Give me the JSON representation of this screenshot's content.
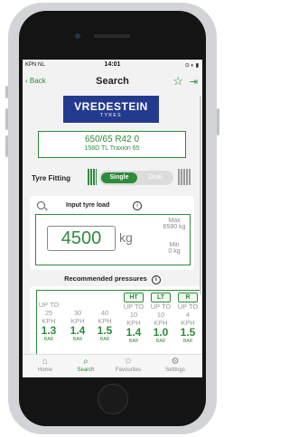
{
  "status": {
    "carrier": "KPN NL",
    "time": "14:01",
    "icons": "⊙ ◐ ▮"
  },
  "nav": {
    "back_label": "Back",
    "title": "Search"
  },
  "logo": {
    "brand": "VREDESTEIN",
    "sub": "TYRES"
  },
  "tyre": {
    "size": "650/65 R42 0",
    "description": "158D TL Traxion 65"
  },
  "fitting": {
    "label": "Tyre Fitting",
    "single": "Single",
    "dual": "Dual",
    "selected": "Single"
  },
  "load": {
    "title": "Input tyre load",
    "value": "4500",
    "unit": "kg",
    "max_label": "Max",
    "max_value": "6580 kg",
    "min_label": "Min",
    "min_value": "0 kg"
  },
  "pressures": {
    "title": "Recommended pressures",
    "columns": [
      {
        "tag": "",
        "l1": "UP TO",
        "l2": "25",
        "l3": "KPH",
        "value": "1.3",
        "unit": "BAR"
      },
      {
        "tag": "",
        "l1": "",
        "l2": "30",
        "l3": "KPH",
        "value": "1.4",
        "unit": "BAR"
      },
      {
        "tag": "",
        "l1": "",
        "l2": "40",
        "l3": "KPH",
        "value": "1.5",
        "unit": "BAR"
      },
      {
        "tag": "HT",
        "l1": "UP TO",
        "l2": "10",
        "l3": "KPH",
        "value": "1.4",
        "unit": "BAR"
      },
      {
        "tag": "LT",
        "l1": "UP TO",
        "l2": "10",
        "l3": "KPH",
        "value": "1.0",
        "unit": "BAR"
      },
      {
        "tag": "R",
        "l1": "UP TO",
        "l2": "4",
        "l3": "KPH",
        "value": "1.5",
        "unit": "BAR"
      }
    ]
  },
  "tabs": [
    {
      "label": "Home",
      "icon": "home-icon",
      "active": false
    },
    {
      "label": "Search",
      "icon": "search-icon",
      "active": true
    },
    {
      "label": "Favourites",
      "icon": "star-icon",
      "active": false
    },
    {
      "label": "Settings",
      "icon": "gear-icon",
      "active": false
    }
  ],
  "colors": {
    "accent": "#2e8b3a",
    "brand": "#233b8f"
  }
}
